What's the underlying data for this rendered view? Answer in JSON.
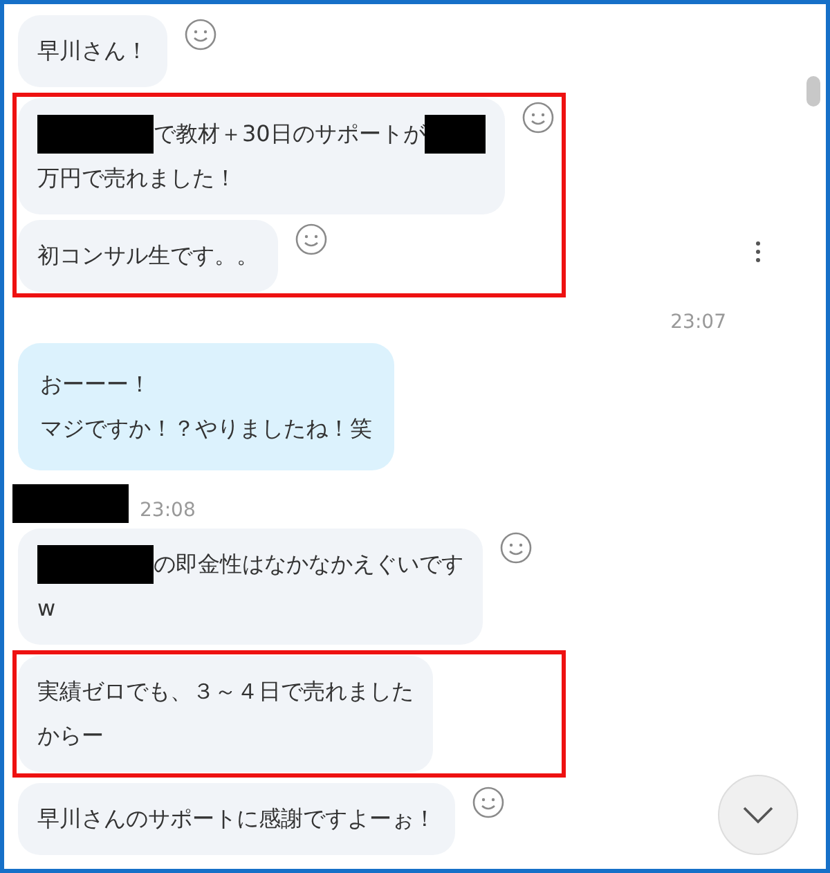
{
  "conversation": [
    {
      "kind": "group",
      "highlighted": false,
      "messages": [
        {
          "kind": "incoming",
          "reaction": true,
          "lines": [
            [
              {
                "kind": "text",
                "text": "早川さん！"
              }
            ]
          ]
        }
      ]
    },
    {
      "kind": "group",
      "highlighted": true,
      "messages": [
        {
          "kind": "incoming",
          "reaction": true,
          "lines": [
            [
              {
                "kind": "redacted_long"
              },
              {
                "kind": "text",
                "text": "で教材＋30日のサポートが"
              },
              {
                "kind": "redacted_short"
              }
            ],
            [
              {
                "kind": "text",
                "text": "万円で売れました！"
              }
            ]
          ]
        },
        {
          "kind": "incoming",
          "reaction": true,
          "lines": [
            [
              {
                "kind": "text",
                "text": "初コンサル生です。。"
              }
            ]
          ]
        }
      ]
    },
    {
      "kind": "time",
      "time": "23:07"
    },
    {
      "kind": "group",
      "highlighted": false,
      "messages": [
        {
          "kind": "outgoing",
          "reaction": false,
          "lines": [
            [
              {
                "kind": "text",
                "text": "おーーー！"
              }
            ],
            [
              {
                "kind": "text",
                "text": "マジですか！？やりましたね！笑"
              }
            ]
          ]
        }
      ]
    },
    {
      "kind": "sender",
      "name": {
        "kind": "redacted_long"
      },
      "time": "23:08"
    },
    {
      "kind": "group",
      "highlighted": false,
      "messages": [
        {
          "kind": "incoming",
          "reaction": true,
          "lines": [
            [
              {
                "kind": "redacted_long"
              },
              {
                "kind": "text",
                "text": "の即金性はなかなかえぐいです"
              }
            ],
            [
              {
                "kind": "text",
                "text": "w"
              }
            ]
          ]
        }
      ]
    },
    {
      "kind": "group",
      "highlighted": true,
      "messages": [
        {
          "kind": "incoming",
          "reaction": false,
          "lines": [
            [
              {
                "kind": "text",
                "text": "実績ゼロでも、３～４日で売れました"
              }
            ],
            [
              {
                "kind": "text",
                "text": "からー"
              }
            ]
          ]
        }
      ]
    },
    {
      "kind": "group",
      "highlighted": false,
      "messages": [
        {
          "kind": "incoming",
          "reaction": true,
          "lines": [
            [
              {
                "kind": "text",
                "text": "早川さんのサポートに感謝ですよーぉ！"
              }
            ]
          ]
        }
      ]
    }
  ]
}
